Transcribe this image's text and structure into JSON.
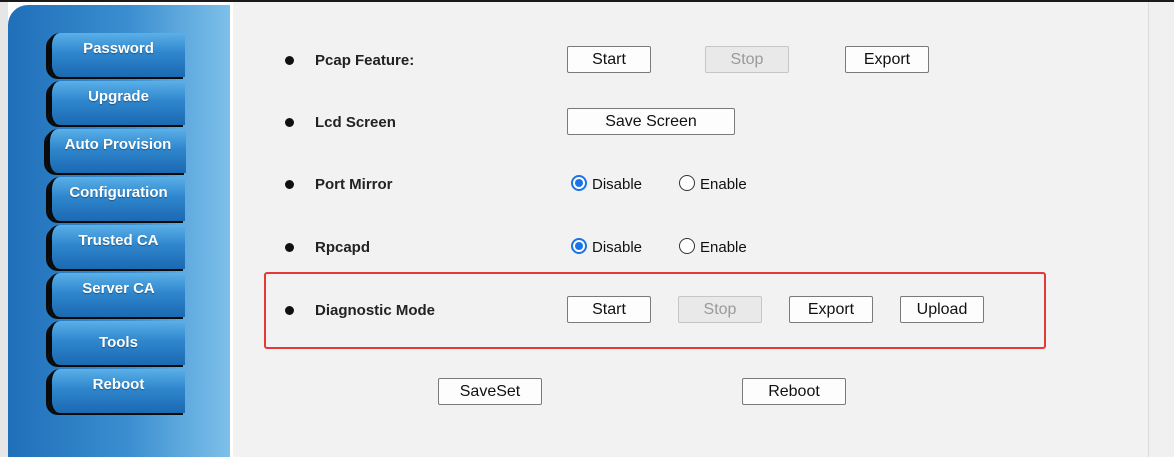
{
  "sidebar": {
    "items": [
      {
        "label": "Password"
      },
      {
        "label": "Upgrade"
      },
      {
        "label": "Auto Provision"
      },
      {
        "label": "Configuration"
      },
      {
        "label": "Trusted CA"
      },
      {
        "label": "Server CA"
      },
      {
        "label": "Tools"
      },
      {
        "label": "Reboot"
      }
    ]
  },
  "rows": {
    "pcap": {
      "label": "Pcap Feature:",
      "start": "Start",
      "stop": "Stop",
      "export": "Export"
    },
    "lcd": {
      "label": "Lcd Screen",
      "save_screen": "Save Screen"
    },
    "port_mirror": {
      "label": "Port Mirror",
      "disable": "Disable",
      "enable": "Enable",
      "selected": "Disable"
    },
    "rpcapd": {
      "label": "Rpcapd",
      "disable": "Disable",
      "enable": "Enable",
      "selected": "Disable"
    },
    "diagnostic": {
      "label": "Diagnostic Mode",
      "start": "Start",
      "stop": "Stop",
      "export": "Export",
      "upload": "Upload"
    }
  },
  "footer": {
    "saveset": "SaveSet",
    "reboot": "Reboot"
  },
  "colors": {
    "highlight": "#e53935",
    "radio_accent": "#1a73e8",
    "sidebar_blue": "#1f6fb9"
  }
}
